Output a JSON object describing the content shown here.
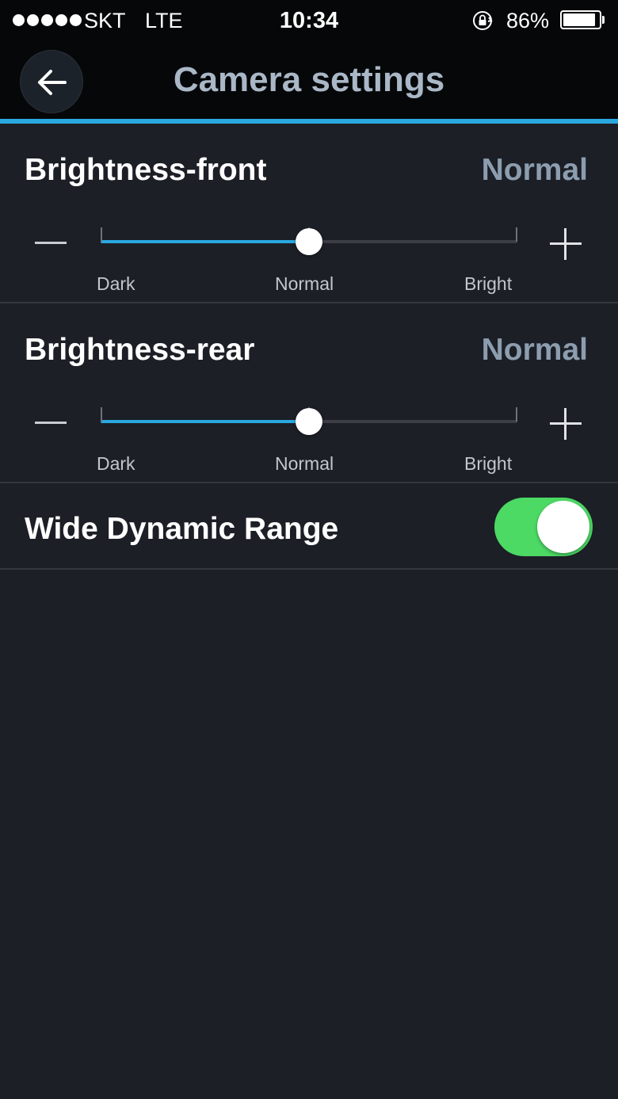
{
  "status_bar": {
    "carrier": "SKT",
    "network": "LTE",
    "time": "10:34",
    "battery_percent": "86%",
    "signal_bars": 5,
    "battery_level": 0.86,
    "icons": [
      "signal-dots-icon",
      "orientation-lock-icon",
      "battery-icon"
    ]
  },
  "header": {
    "title": "Camera settings",
    "back_icon": "back-arrow-icon"
  },
  "sections": {
    "brightness_front": {
      "title": "Brightness-front",
      "value": "Normal",
      "slider_fraction": 0.5,
      "scale_labels": [
        "Dark",
        "Normal",
        "Bright"
      ]
    },
    "brightness_rear": {
      "title": "Brightness-rear",
      "value": "Normal",
      "slider_fraction": 0.5,
      "scale_labels": [
        "Dark",
        "Normal",
        "Bright"
      ]
    },
    "wdr": {
      "title": "Wide Dynamic Range",
      "enabled": true
    }
  },
  "colors": {
    "accent": "#2aa8e0",
    "toggle_on": "#4cd964",
    "background": "#1c1f26",
    "header_bg": "#060709",
    "title_color": "#a9b7c6",
    "value_color": "#8c9daf"
  }
}
